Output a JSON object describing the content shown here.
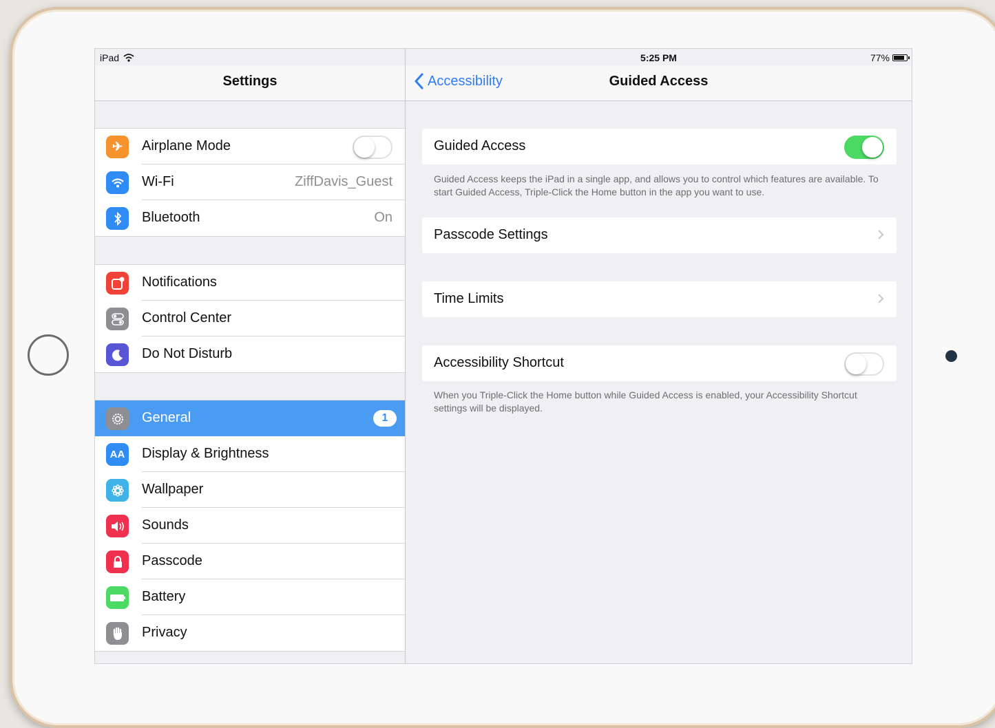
{
  "status_bar": {
    "device": "iPad",
    "time": "5:25 PM",
    "battery": "77%"
  },
  "master": {
    "title": "Settings",
    "groups": [
      [
        {
          "label": "Airplane Mode",
          "icon": "airplane-icon",
          "color": "#f7932e",
          "toggle": false
        },
        {
          "label": "Wi-Fi",
          "icon": "wifi-icon",
          "color": "#2f8cf5",
          "value": "ZiffDavis_Guest"
        },
        {
          "label": "Bluetooth",
          "icon": "bluetooth-icon",
          "color": "#2f8cf5",
          "value": "On"
        }
      ],
      [
        {
          "label": "Notifications",
          "icon": "notifications-icon",
          "color": "#f04237"
        },
        {
          "label": "Control Center",
          "icon": "control-center-icon",
          "color": "#8e8e93"
        },
        {
          "label": "Do Not Disturb",
          "icon": "moon-icon",
          "color": "#5856d6"
        }
      ],
      [
        {
          "label": "General",
          "icon": "gear-icon",
          "color": "#8e8e93",
          "badge": "1",
          "selected": true
        },
        {
          "label": "Display & Brightness",
          "icon": "display-brightness-icon",
          "color": "#2f8cf5"
        },
        {
          "label": "Wallpaper",
          "icon": "wallpaper-icon",
          "color": "#3fb2e8"
        },
        {
          "label": "Sounds",
          "icon": "speaker-icon",
          "color": "#f0304f"
        },
        {
          "label": "Passcode",
          "icon": "lock-icon",
          "color": "#f0304f"
        },
        {
          "label": "Battery",
          "icon": "battery-icon",
          "color": "#4cd964"
        },
        {
          "label": "Privacy",
          "icon": "hand-icon",
          "color": "#8e8e93"
        }
      ]
    ]
  },
  "detail": {
    "back_label": "Accessibility",
    "title": "Guided Access",
    "guided_access": {
      "label": "Guided Access",
      "toggle": true
    },
    "guided_access_note": "Guided Access keeps the iPad in a single app, and allows you to control which features are available. To start Guided Access, Triple-Click the Home button in the app you want to use.",
    "passcode_settings": "Passcode Settings",
    "time_limits": "Time Limits",
    "accessibility_shortcut": {
      "label": "Accessibility Shortcut",
      "toggle": false
    },
    "shortcut_note": "When you Triple-Click the Home button while Guided Access is enabled, your Accessibility Shortcut settings will be displayed."
  }
}
